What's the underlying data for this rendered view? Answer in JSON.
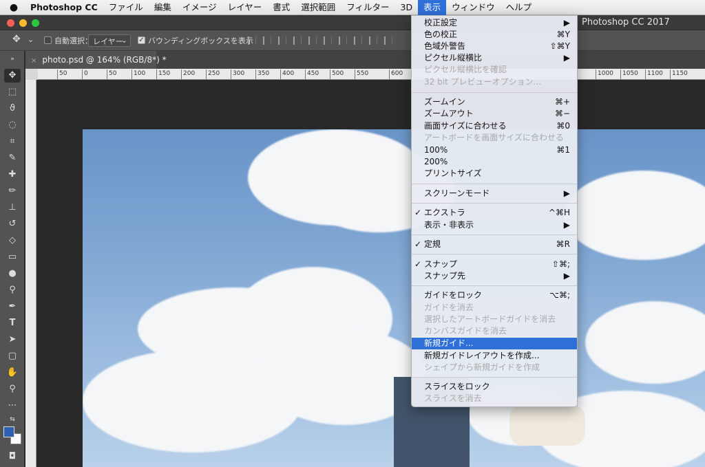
{
  "menubar": {
    "app": "Photoshop CC",
    "items": [
      "ファイル",
      "編集",
      "イメージ",
      "レイヤー",
      "書式",
      "選択範囲",
      "フィルター",
      "3D",
      "表示",
      "ウィンドウ",
      "ヘルプ"
    ]
  },
  "window": {
    "title": "Photoshop CC 2017"
  },
  "options": {
    "auto_select_label": "自動選択：",
    "auto_select_value": "レイヤー",
    "bounding_box_label": "バウンディングボックスを表示"
  },
  "document": {
    "tab_title": "photo.psd @ 164% (RGB/8*) *",
    "close": "×"
  },
  "rulers": {
    "h_ticks": [
      "50",
      "0",
      "50",
      "100",
      "150",
      "200",
      "250",
      "300",
      "350",
      "400",
      "450",
      "500",
      "550",
      "600",
      "1000",
      "1050",
      "1100",
      "1150"
    ]
  },
  "colors": {
    "accent": "#2f6fd8",
    "foreground_swatch": "#2f5fb0",
    "background_swatch": "#ffffff"
  },
  "view_menu": {
    "proof_setup": "校正設定",
    "proof_colors": "色の校正",
    "proof_colors_sc": "⌘Y",
    "gamut_warning": "色域外警告",
    "gamut_warning_sc": "⇧⌘Y",
    "pixel_aspect": "ピクセル縦横比",
    "pixel_aspect_correct": "ピクセル縦横比を確認",
    "preview_32bit": "32 bit プレビューオプション...",
    "zoom_in": "ズームイン",
    "zoom_in_sc": "⌘+",
    "zoom_out": "ズームアウト",
    "zoom_out_sc": "⌘−",
    "fit_screen": "画面サイズに合わせる",
    "fit_screen_sc": "⌘0",
    "fit_artboard": "アートボードを画面サイズに合わせる",
    "zoom_100": "100%",
    "zoom_100_sc": "⌘1",
    "zoom_200": "200%",
    "print_size": "プリントサイズ",
    "screen_mode": "スクリーンモード",
    "extras": "エクストラ",
    "extras_sc": "^⌘H",
    "show": "表示・非表示",
    "rulers": "定規",
    "rulers_sc": "⌘R",
    "snap": "スナップ",
    "snap_sc": "⇧⌘;",
    "snap_to": "スナップ先",
    "lock_guides": "ガイドをロック",
    "lock_guides_sc": "⌥⌘;",
    "clear_guides": "ガイドを消去",
    "clear_artboard_guides": "選択したアートボードガイドを消去",
    "clear_canvas_guides": "カンバスガイドを消去",
    "new_guide": "新規ガイド...",
    "new_guide_layout": "新規ガイドレイアウトを作成...",
    "guides_from_shape": "シェイプから新規ガイドを作成",
    "lock_slices": "スライスをロック",
    "clear_slices": "スライスを消去",
    "checkmark": "✓",
    "submenu_arrow": "▶"
  }
}
